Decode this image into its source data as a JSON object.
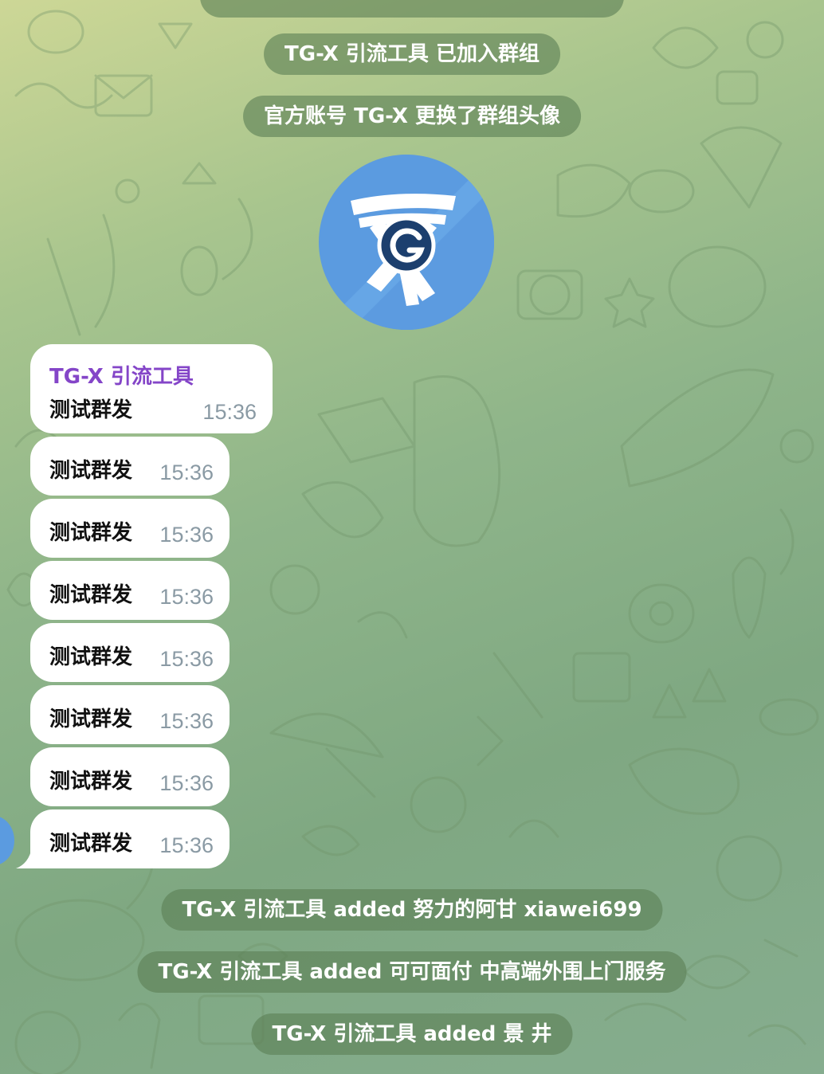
{
  "service_messages_top": [
    "TG-X 引流工具 已加入群组",
    "官方账号 TG-X 更换了群组头像"
  ],
  "group_photo": {
    "icon": "tgx-logo-icon",
    "colors": {
      "light": "#66a6e6",
      "dark": "#4a86d4",
      "logo": "#1c3f6e"
    }
  },
  "messages": [
    {
      "sender": "TG-X 引流工具",
      "text": "测试群发",
      "time": "15:36"
    },
    {
      "text": "测试群发",
      "time": "15:36"
    },
    {
      "text": "测试群发",
      "time": "15:36"
    },
    {
      "text": "测试群发",
      "time": "15:36"
    },
    {
      "text": "测试群发",
      "time": "15:36"
    },
    {
      "text": "测试群发",
      "time": "15:36"
    },
    {
      "text": "测试群发",
      "time": "15:36"
    },
    {
      "text": "测试群发",
      "time": "15:36"
    }
  ],
  "service_messages_bottom": [
    "TG-X 引流工具 added 努力的阿甘 xiawei699",
    "TG-X 引流工具 added 可可面付 中高端外围上门服务",
    "TG-X 引流工具 added 景 井"
  ],
  "colors": {
    "bubble": "#ffffff",
    "sender": "#8445c8",
    "time": "#8a9aa4",
    "service_pill": "#5c8056"
  }
}
